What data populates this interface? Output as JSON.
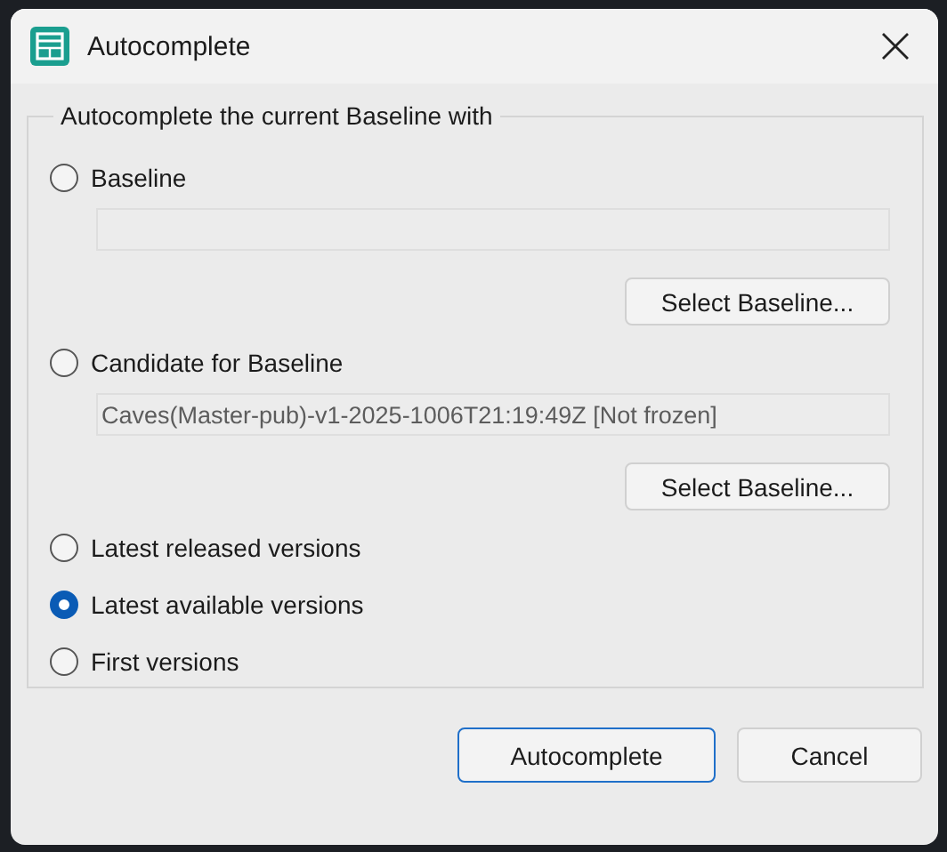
{
  "window": {
    "title": "Autocomplete"
  },
  "group": {
    "label": "Autocomplete the current Baseline with",
    "options": [
      {
        "kind": "with-field",
        "label": "Baseline",
        "selected": false,
        "button": "Select Baseline..."
      },
      {
        "kind": "with-field",
        "label": "Candidate for Baseline",
        "selected": false,
        "value": "Caves(Master-pub)-v1-2025-1006T21:19:49Z [Not frozen]",
        "button": "Select Baseline..."
      },
      {
        "kind": "plain",
        "label": "Latest released versions",
        "selected": false
      },
      {
        "kind": "plain",
        "label": "Latest available versions",
        "selected": true
      },
      {
        "kind": "plain",
        "label": "First versions",
        "selected": false
      }
    ]
  },
  "buttons": [
    {
      "label": "Autocomplete",
      "default": true
    },
    {
      "label": "Cancel",
      "default": false
    }
  ]
}
